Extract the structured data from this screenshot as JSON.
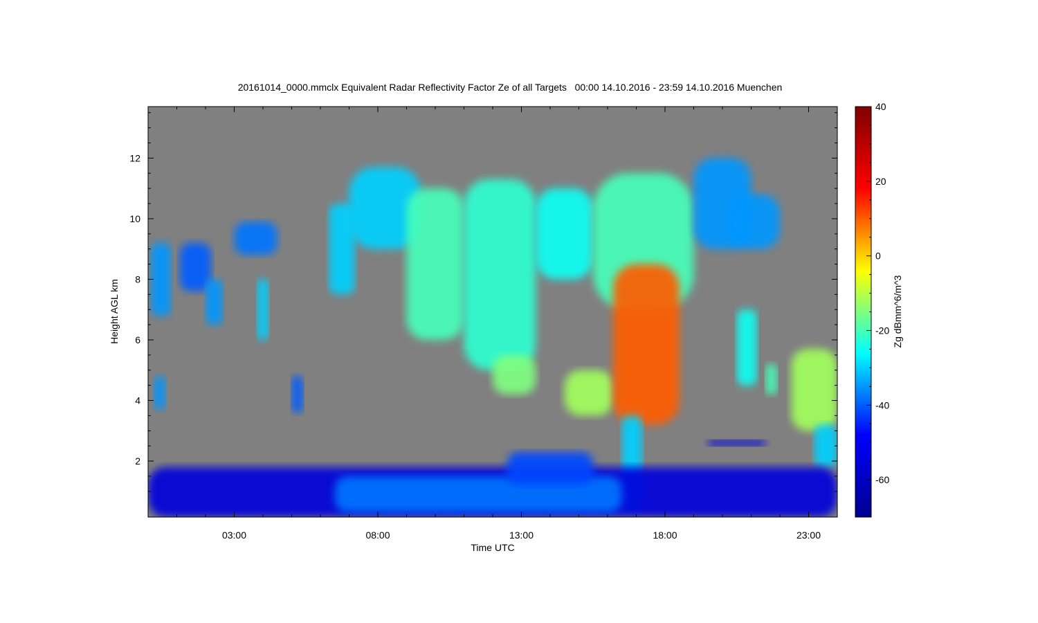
{
  "chart_data": {
    "type": "heatmap",
    "title": "20161014_0000.mmclx Equivalent Radar Reflectivity Factor Ze of all Targets   00:00 14.10.2016 - 23:59 14.10.2016 Muenchen",
    "xlabel": "Time UTC",
    "ylabel": "Height AGL km",
    "x_unit": "hours UTC",
    "xlim": [
      0.0,
      24.0
    ],
    "ylim": [
      0.15,
      13.7
    ],
    "x_ticks": [
      {
        "value": 3,
        "label": "03:00"
      },
      {
        "value": 8,
        "label": "08:00"
      },
      {
        "value": 13,
        "label": "13:00"
      },
      {
        "value": 18,
        "label": "18:00"
      },
      {
        "value": 23,
        "label": "23:00"
      }
    ],
    "y_ticks": [
      {
        "value": 2,
        "label": "2"
      },
      {
        "value": 4,
        "label": "4"
      },
      {
        "value": 6,
        "label": "6"
      },
      {
        "value": 8,
        "label": "8"
      },
      {
        "value": 10,
        "label": "10"
      },
      {
        "value": 12,
        "label": "12"
      }
    ],
    "colorbar": {
      "label": "Zg dBmm^6/m^3",
      "range": [
        -70,
        40
      ],
      "ticks": [
        {
          "value": 40,
          "label": "40"
        },
        {
          "value": 20,
          "label": "20"
        },
        {
          "value": 0,
          "label": "0"
        },
        {
          "value": -20,
          "label": "-20"
        },
        {
          "value": -40,
          "label": "-40"
        },
        {
          "value": -60,
          "label": "-60"
        }
      ],
      "colormap": [
        "#00008f",
        "#0000ff",
        "#00ffff",
        "#ffff00",
        "#ff0000",
        "#800000"
      ]
    },
    "background_color": "#808080",
    "cloud_features": [
      {
        "t0": 0.1,
        "t1": 0.8,
        "h0": 6.8,
        "h1": 9.2,
        "z": -35
      },
      {
        "t0": 1.1,
        "t1": 2.2,
        "h0": 7.6,
        "h1": 9.2,
        "z": -40
      },
      {
        "t0": 2.0,
        "t1": 2.6,
        "h0": 6.5,
        "h1": 8.0,
        "z": -35
      },
      {
        "t0": 3.0,
        "t1": 4.5,
        "h0": 8.8,
        "h1": 9.9,
        "z": -38
      },
      {
        "t0": 3.8,
        "t1": 4.2,
        "h0": 6.0,
        "h1": 8.0,
        "z": -30
      },
      {
        "t0": 0.2,
        "t1": 0.6,
        "h0": 3.7,
        "h1": 4.8,
        "z": -35
      },
      {
        "t0": 5.0,
        "t1": 5.4,
        "h0": 3.6,
        "h1": 4.8,
        "z": -40
      },
      {
        "t0": 6.3,
        "t1": 7.2,
        "h0": 7.5,
        "h1": 10.5,
        "z": -30
      },
      {
        "t0": 7.0,
        "t1": 9.5,
        "h0": 9.0,
        "h1": 11.7,
        "z": -30
      },
      {
        "t0": 9.0,
        "t1": 11.0,
        "h0": 6.0,
        "h1": 11.0,
        "z": -20
      },
      {
        "t0": 11.0,
        "t1": 13.5,
        "h0": 5.0,
        "h1": 11.3,
        "z": -22
      },
      {
        "t0": 12.0,
        "t1": 13.5,
        "h0": 4.2,
        "h1": 5.5,
        "z": -15
      },
      {
        "t0": 13.5,
        "t1": 15.5,
        "h0": 8.0,
        "h1": 11.0,
        "z": -25
      },
      {
        "t0": 14.5,
        "t1": 16.2,
        "h0": 3.5,
        "h1": 5.0,
        "z": -12
      },
      {
        "t0": 15.5,
        "t1": 19.0,
        "h0": 7.0,
        "h1": 11.5,
        "z": -20
      },
      {
        "t0": 16.2,
        "t1": 18.5,
        "h0": 3.2,
        "h1": 8.5,
        "z": 10
      },
      {
        "t0": 16.5,
        "t1": 17.2,
        "h0": 0.4,
        "h1": 3.5,
        "z": -30
      },
      {
        "t0": 19.0,
        "t1": 21.0,
        "h0": 9.0,
        "h1": 12.0,
        "z": -35
      },
      {
        "t0": 20.2,
        "t1": 22.0,
        "h0": 9.0,
        "h1": 10.8,
        "z": -35
      },
      {
        "t0": 20.5,
        "t1": 21.2,
        "h0": 4.5,
        "h1": 7.0,
        "z": -25
      },
      {
        "t0": 21.5,
        "t1": 21.9,
        "h0": 4.2,
        "h1": 5.2,
        "z": -20
      },
      {
        "t0": 22.4,
        "t1": 24.0,
        "h0": 3.0,
        "h1": 5.7,
        "z": -12
      },
      {
        "t0": 23.2,
        "t1": 24.0,
        "h0": 1.8,
        "h1": 3.2,
        "z": -30
      },
      {
        "t0": 19.5,
        "t1": 21.5,
        "h0": 2.5,
        "h1": 2.7,
        "z": -55
      },
      {
        "t0": 0.0,
        "t1": 24.0,
        "h0": 0.15,
        "h1": 1.8,
        "z": -55
      },
      {
        "t0": 6.5,
        "t1": 16.5,
        "h0": 0.3,
        "h1": 1.5,
        "z": -38
      },
      {
        "t0": 12.5,
        "t1": 15.5,
        "h0": 1.2,
        "h1": 2.3,
        "z": -42
      }
    ]
  }
}
